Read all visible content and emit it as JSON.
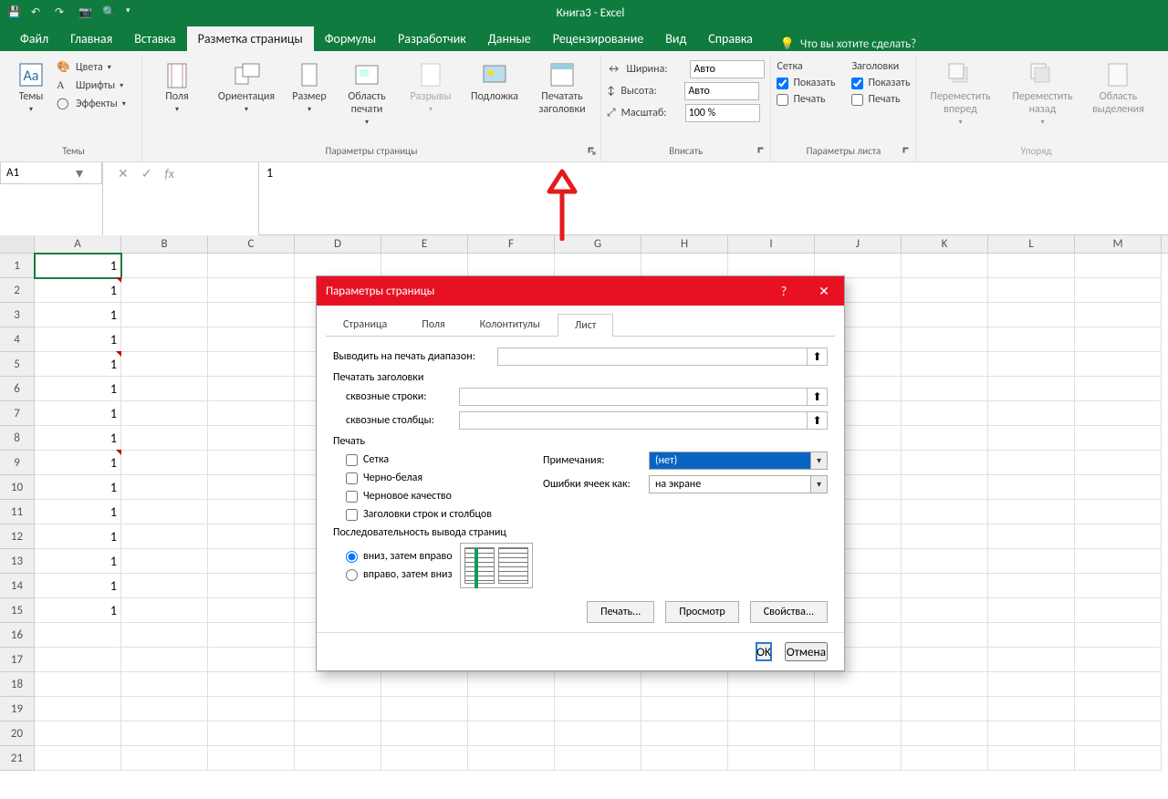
{
  "title": "Книга3  -  Excel",
  "tabs": {
    "file": "Файл",
    "home": "Главная",
    "insert": "Вставка",
    "pagelayout": "Разметка страницы",
    "formulas": "Формулы",
    "developer": "Разработчик",
    "data": "Данные",
    "review": "Рецензирование",
    "view": "Вид",
    "help": "Справка",
    "tellme": "Что вы хотите сделать?"
  },
  "groups": {
    "themes": {
      "label": "Темы",
      "themes_btn": "Темы",
      "colors": "Цвета",
      "fonts": "Шрифты",
      "effects": "Эффекты"
    },
    "pagesetup": {
      "label": "Параметры страницы",
      "margins": "Поля",
      "orientation": "Ориентация",
      "size": "Размер",
      "printarea": "Область печати",
      "breaks": "Разрывы",
      "background": "Подложка",
      "titles": "Печатать заголовки"
    },
    "fit": {
      "label": "Вписать",
      "width": "Ширина:",
      "height": "Высота:",
      "scale": "Масштаб:",
      "width_val": "Авто",
      "height_val": "Авто",
      "scale_val": "100 %"
    },
    "sheetopts": {
      "label": "Параметры листа",
      "grid_hdr": "Сетка",
      "headings_hdr": "Заголовки",
      "show": "Показать",
      "print": "Печать"
    },
    "arrange": {
      "label": "Упоряд",
      "bring": "Переместить вперед",
      "send": "Переместить назад",
      "selpane": "Область выделения"
    }
  },
  "namebox": "A1",
  "fx_value": "1",
  "cols": [
    "A",
    "B",
    "C",
    "D",
    "E",
    "F",
    "G",
    "H",
    "I",
    "J",
    "K",
    "L",
    "M"
  ],
  "rows": [
    {
      "n": 1,
      "v": "1",
      "flag": false,
      "sel": true
    },
    {
      "n": 2,
      "v": "1",
      "flag": true
    },
    {
      "n": 3,
      "v": "1",
      "flag": false
    },
    {
      "n": 4,
      "v": "1",
      "flag": false
    },
    {
      "n": 5,
      "v": "1",
      "flag": true
    },
    {
      "n": 6,
      "v": "1",
      "flag": false
    },
    {
      "n": 7,
      "v": "1",
      "flag": false
    },
    {
      "n": 8,
      "v": "1",
      "flag": false
    },
    {
      "n": 9,
      "v": "1",
      "flag": true
    },
    {
      "n": 10,
      "v": "1",
      "flag": false
    },
    {
      "n": 11,
      "v": "1",
      "flag": false
    },
    {
      "n": 12,
      "v": "1",
      "flag": false
    },
    {
      "n": 13,
      "v": "1",
      "flag": false
    },
    {
      "n": 14,
      "v": "1",
      "flag": false
    },
    {
      "n": 15,
      "v": "1",
      "flag": false
    },
    {
      "n": 16,
      "v": ""
    },
    {
      "n": 17,
      "v": ""
    },
    {
      "n": 18,
      "v": ""
    },
    {
      "n": 19,
      "v": ""
    },
    {
      "n": 20,
      "v": ""
    },
    {
      "n": 21,
      "v": ""
    }
  ],
  "dialog": {
    "title": "Параметры страницы",
    "tabs": {
      "page": "Страница",
      "margins": "Поля",
      "headerfooter": "Колонтитулы",
      "sheet": "Лист"
    },
    "print_range_lbl": "Выводить на печать диапазон:",
    "print_titles_hdr": "Печатать заголовки",
    "rows_repeat_lbl": "сквозные строки:",
    "cols_repeat_lbl": "сквозные столбцы:",
    "print_hdr": "Печать",
    "grid_chk": "Сетка",
    "bw_chk": "Черно-белая",
    "draft_chk": "Черновое качество",
    "rowcol_chk": "Заголовки строк и столбцов",
    "comments_lbl": "Примечания:",
    "comments_val": "(нет)",
    "errors_lbl": "Ошибки ячеек как:",
    "errors_val": "на экране",
    "order_hdr": "Последовательность вывода страниц",
    "order_down": "вниз, затем вправо",
    "order_over": "вправо, затем вниз",
    "btn_print": "Печать...",
    "btn_preview": "Просмотр",
    "btn_options": "Свойства...",
    "btn_ok": "OK",
    "btn_cancel": "Отмена"
  }
}
